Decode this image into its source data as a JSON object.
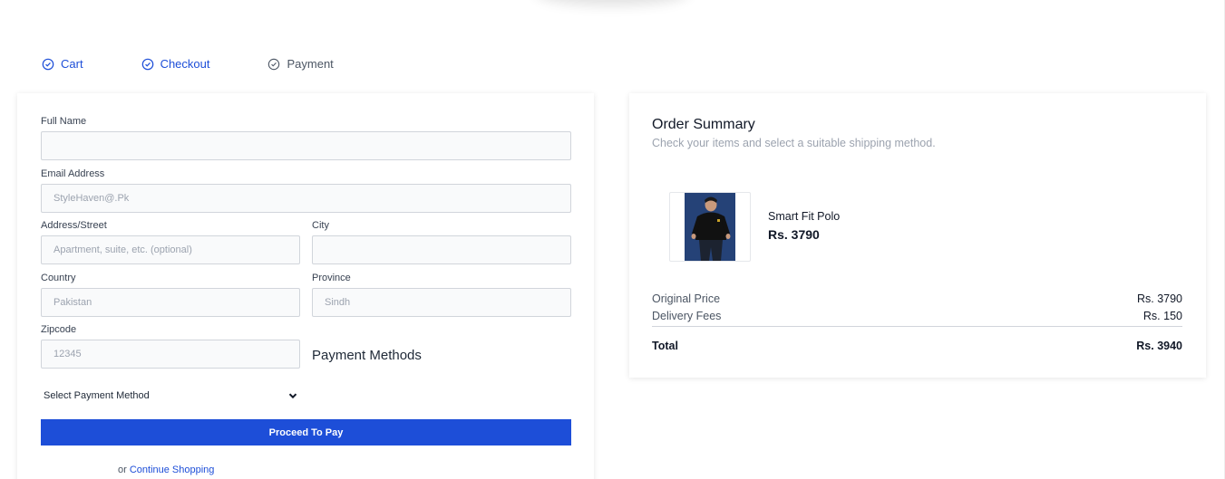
{
  "steps": [
    {
      "label": "Cart",
      "state": "done"
    },
    {
      "label": "Checkout",
      "state": "done"
    },
    {
      "label": "Payment",
      "state": "pending"
    }
  ],
  "form": {
    "full_name_label": "Full Name",
    "full_name_value": "",
    "email_label": "Email Address",
    "email_placeholder": "StyleHaven@.Pk",
    "address_label": "Address/Street",
    "address_placeholder": "Apartment, suite, etc. (optional)",
    "city_label": "City",
    "city_value": "",
    "country_label": "Country",
    "country_placeholder": "Pakistan",
    "province_label": "Province",
    "province_placeholder": "Sindh",
    "zipcode_label": "Zipcode",
    "zipcode_placeholder": "12345",
    "payment_methods_title": "Payment Methods",
    "payment_select_value": "Select Payment Method",
    "pay_button": "Proceed To Pay",
    "or_text": "or",
    "continue_link": "Continue Shopping"
  },
  "summary": {
    "title": "Order Summary",
    "subtitle": "Check your items and select a suitable shipping method.",
    "product_name": "Smart Fit Polo",
    "product_price": "Rs. 3790",
    "original_price_label": "Original Price",
    "original_price_value": "Rs. 3790",
    "delivery_label": "Delivery Fees",
    "delivery_value": "Rs. 150",
    "total_label": "Total",
    "total_value": "Rs. 3940"
  },
  "colors": {
    "accent": "#1d4ed8",
    "input_bg": "#f9fafb",
    "muted": "#9ca3af"
  },
  "icons": {
    "step": "check-circle-icon",
    "select": "chevron-down-icon"
  }
}
